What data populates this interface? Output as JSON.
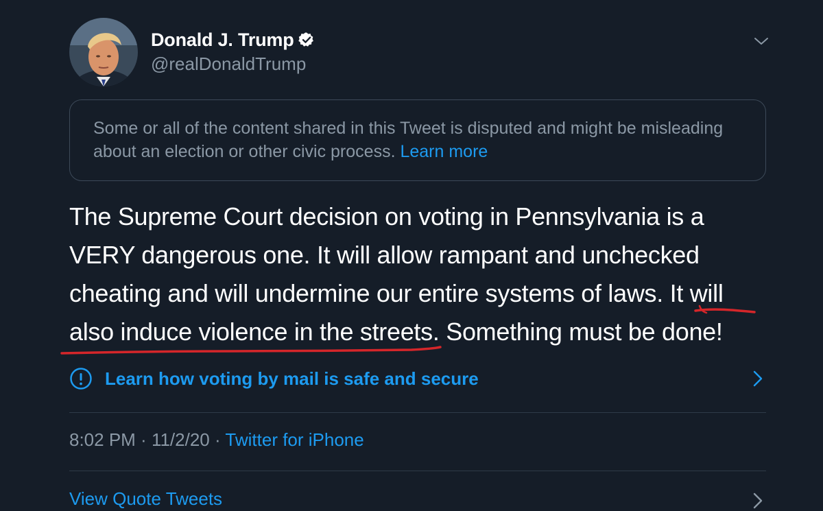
{
  "author": {
    "display_name": "Donald J. Trump",
    "handle": "@realDonaldTrump",
    "verified": true,
    "avatar_icon": "profile-photo"
  },
  "notice": {
    "text": "Some or all of the content shared in this Tweet is disputed and might be misleading about an election or other civic process.",
    "link_label": "Learn more"
  },
  "tweet": {
    "segments": [
      "The Supreme Court decision on voting in Pennsylvania is a VERY dangerous one. It will allow rampant and unchecked cheating and will undermine our entire systems of laws. ",
      "It will also induce violence in the streets",
      ". Something must be done!"
    ]
  },
  "voting_prompt": {
    "label": "Learn how voting by mail is safe and secure",
    "icon": "info-circle-icon"
  },
  "meta": {
    "time": "8:02 PM",
    "separator": " · ",
    "date": "11/2/20",
    "source": "Twitter for iPhone"
  },
  "actions": {
    "view_quote_tweets": "View Quote Tweets"
  },
  "colors": {
    "background": "#151d28",
    "accent": "#1d9bf0",
    "muted_text": "#8b98a5",
    "annotation": "#d5262a"
  }
}
